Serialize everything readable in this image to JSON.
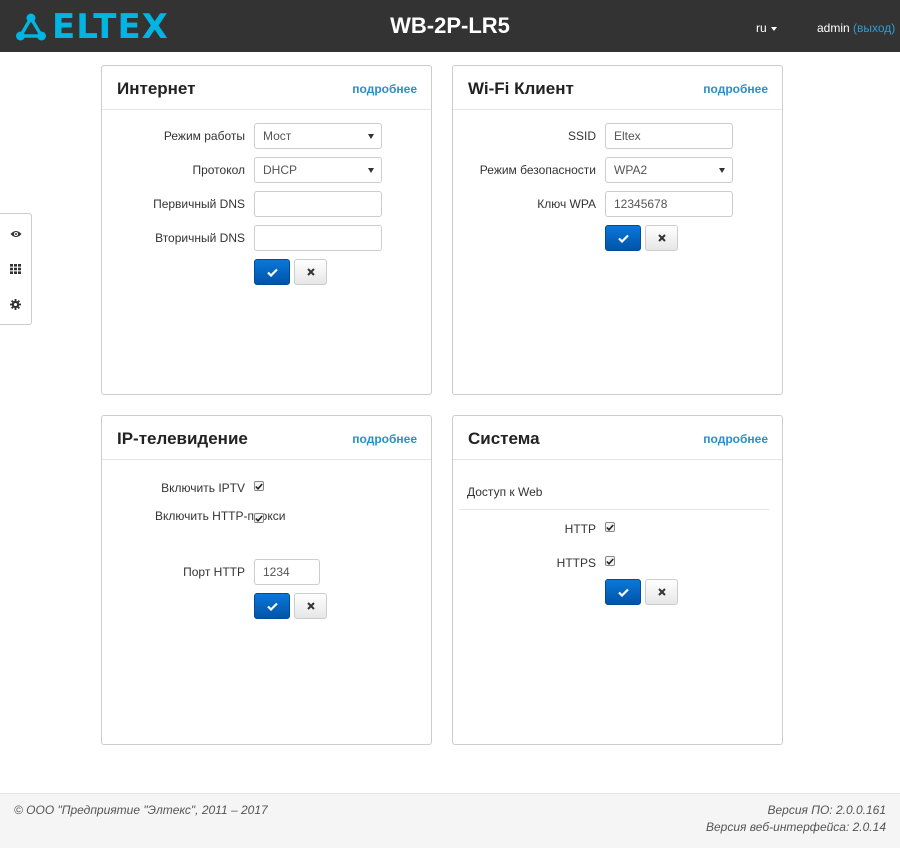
{
  "header": {
    "brand": "ELTEX",
    "device": "WB-2P-LR5",
    "language": "ru",
    "user": "admin",
    "logout": "(выход)"
  },
  "sidebar": {
    "items": [
      "eye-icon",
      "grid-icon",
      "gear-icon"
    ]
  },
  "internet": {
    "title": "Интернет",
    "more": "подробнее",
    "mode_label": "Режим работы",
    "mode_value": "Мост",
    "protocol_label": "Протокол",
    "protocol_value": "DHCP",
    "dns1_label": "Первичный DNS",
    "dns1_value": "",
    "dns2_label": "Вторичный DNS",
    "dns2_value": ""
  },
  "wifi": {
    "title": "Wi-Fi Клиент",
    "more": "подробнее",
    "ssid_label": "SSID",
    "ssid_value": "Eltex",
    "security_label": "Режим безопасности",
    "security_value": "WPA2",
    "key_label": "Ключ WPA",
    "key_value": "12345678"
  },
  "iptv": {
    "title": "IP-телевидение",
    "more": "подробнее",
    "enable_label": "Включить IPTV",
    "enable_checked": true,
    "proxy_label": "Включить HTTP-прокси",
    "proxy_checked": true,
    "port_label": "Порт HTTP",
    "port_value": "1234"
  },
  "system": {
    "title": "Система",
    "more": "подробнее",
    "web_access_label": "Доступ к Web",
    "http_label": "HTTP",
    "http_checked": true,
    "https_label": "HTTPS",
    "https_checked": true
  },
  "footer": {
    "copyright": "© ООО \"Предприятие \"Элтекс\", 2011 – 2017",
    "fw_version": "Версия ПО: 2.0.0.161",
    "web_version": "Версия веб-интерфейса: 2.0.14"
  },
  "colors": {
    "topbar": "#333333",
    "brand": "#00b5e2",
    "link": "#2a8fc8",
    "primary_button": "#0a6fc9"
  }
}
